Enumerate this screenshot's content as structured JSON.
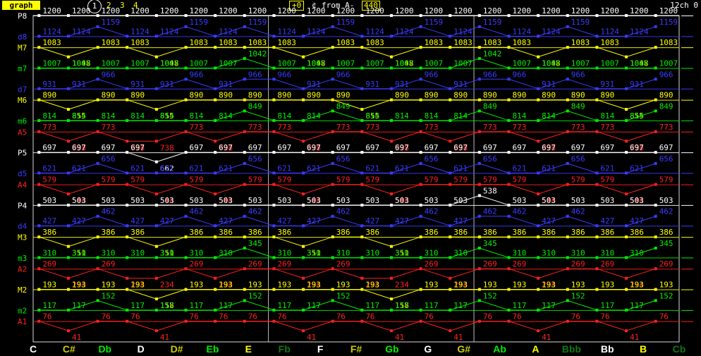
{
  "header": {
    "mode_label": "graph",
    "pages": [
      "1",
      "2",
      "3",
      "4"
    ],
    "offset": "+0",
    "cents": "¢",
    "from_label": "from A-",
    "ref_pitch": "440",
    "channel": "12ch 0"
  },
  "colors": {
    "P": "#ffffff",
    "M": "#ffff00",
    "m": "#00ee00",
    "d": "#3b3bff",
    "A": "#ff2020",
    "grid": "#d8d8d8"
  },
  "rows": [
    {
      "label": "P8",
      "color": "P",
      "values": [
        1200,
        1200,
        1200,
        1200,
        1200,
        1200,
        1200,
        1200,
        1200,
        1200,
        1200,
        1200,
        1200,
        1200,
        1200,
        1200,
        1200,
        1200,
        1200,
        1200,
        1200,
        1200
      ]
    },
    {
      "label": "d8",
      "color": "d",
      "values": [
        1124,
        1124,
        1159,
        1124,
        1124,
        1159,
        1124,
        1159,
        1124,
        1124,
        1159,
        1124,
        1124,
        1159,
        1124,
        1159,
        1124,
        1124,
        1159,
        1124,
        1124,
        1159
      ]
    },
    {
      "label": "M7",
      "color": "M",
      "values": [
        1083,
        1048,
        1083,
        1083,
        1048,
        1083,
        1083,
        1083,
        1083,
        1048,
        1083,
        1083,
        1048,
        1083,
        1083,
        1083,
        1083,
        1048,
        1083,
        1083,
        1048,
        1083
      ]
    },
    {
      "label": "m7",
      "color": "m",
      "values": [
        1007,
        1007,
        1007,
        1007,
        1007,
        1007,
        1007,
        1042,
        1007,
        1007,
        1007,
        1007,
        1007,
        1007,
        1007,
        1042,
        1007,
        1007,
        1007,
        1007,
        1007,
        1007
      ]
    },
    {
      "label": "d7",
      "color": "d",
      "values": [
        931,
        931,
        966,
        931,
        931,
        966,
        931,
        966,
        966,
        931,
        966,
        931,
        931,
        966,
        931,
        966,
        966,
        931,
        966,
        931,
        931,
        966
      ]
    },
    {
      "label": "M6",
      "color": "M",
      "values": [
        890,
        855,
        890,
        890,
        855,
        890,
        890,
        890,
        890,
        890,
        890,
        855,
        890,
        890,
        890,
        890,
        890,
        890,
        890,
        890,
        855,
        890
      ]
    },
    {
      "label": "m6",
      "color": "m",
      "values": [
        814,
        814,
        814,
        814,
        814,
        814,
        814,
        849,
        814,
        814,
        849,
        814,
        814,
        814,
        814,
        849,
        814,
        814,
        849,
        814,
        814,
        849
      ]
    },
    {
      "label": "A5",
      "color": "A",
      "values": [
        773,
        738,
        773,
        738,
        738,
        773,
        738,
        773,
        773,
        738,
        773,
        773,
        738,
        773,
        738,
        773,
        773,
        738,
        773,
        773,
        738,
        773
      ]
    },
    {
      "label": "P5",
      "color": "P",
      "values": [
        697,
        697,
        697,
        697,
        662,
        697,
        697,
        697,
        697,
        697,
        697,
        697,
        697,
        697,
        697,
        697,
        697,
        697,
        697,
        697,
        697,
        697
      ]
    },
    {
      "label": "d5",
      "color": "d",
      "values": [
        621,
        621,
        656,
        621,
        621,
        621,
        621,
        656,
        621,
        621,
        656,
        621,
        621,
        656,
        621,
        656,
        621,
        621,
        656,
        621,
        621,
        656
      ]
    },
    {
      "label": "A4",
      "color": "A",
      "values": [
        579,
        544,
        579,
        579,
        544,
        579,
        544,
        579,
        579,
        544,
        579,
        579,
        544,
        579,
        579,
        579,
        579,
        544,
        579,
        579,
        544,
        579
      ]
    },
    {
      "label": "P4",
      "color": "P",
      "values": [
        503,
        503,
        503,
        503,
        503,
        503,
        503,
        503,
        503,
        503,
        503,
        503,
        503,
        503,
        503,
        538,
        503,
        503,
        503,
        503,
        503,
        503
      ]
    },
    {
      "label": "d4",
      "color": "d",
      "values": [
        427,
        427,
        462,
        427,
        427,
        462,
        427,
        462,
        427,
        427,
        462,
        427,
        427,
        462,
        427,
        462,
        462,
        427,
        462,
        427,
        427,
        462
      ]
    },
    {
      "label": "M3",
      "color": "M",
      "values": [
        386,
        351,
        386,
        386,
        351,
        386,
        386,
        386,
        386,
        351,
        386,
        386,
        351,
        386,
        386,
        386,
        386,
        386,
        386,
        386,
        386,
        386
      ]
    },
    {
      "label": "m3",
      "color": "m",
      "values": [
        310,
        310,
        310,
        310,
        310,
        310,
        310,
        345,
        310,
        310,
        310,
        310,
        310,
        310,
        310,
        345,
        310,
        310,
        310,
        310,
        310,
        345
      ]
    },
    {
      "label": "A2",
      "color": "A",
      "values": [
        269,
        234,
        269,
        234,
        234,
        269,
        234,
        269,
        269,
        234,
        269,
        234,
        234,
        269,
        234,
        269,
        269,
        234,
        269,
        269,
        234,
        269
      ]
    },
    {
      "label": "M2",
      "color": "M",
      "values": [
        193,
        193,
        193,
        193,
        158,
        193,
        193,
        193,
        193,
        193,
        193,
        193,
        158,
        193,
        193,
        193,
        193,
        193,
        193,
        193,
        193,
        193
      ]
    },
    {
      "label": "m2",
      "color": "m",
      "values": [
        117,
        117,
        152,
        117,
        117,
        117,
        117,
        152,
        117,
        117,
        152,
        117,
        117,
        117,
        117,
        152,
        117,
        117,
        152,
        117,
        117,
        152
      ]
    },
    {
      "label": "A1",
      "color": "A",
      "values": [
        76,
        41,
        76,
        76,
        41,
        76,
        76,
        76,
        76,
        41,
        76,
        76,
        41,
        76,
        41,
        76,
        76,
        41,
        76,
        76,
        41,
        76
      ]
    }
  ],
  "bottom_notes": [
    {
      "name": "C",
      "color": "#ffffff"
    },
    {
      "name": "C#",
      "color": "#cccc00"
    },
    {
      "name": "Db",
      "color": "#00ee00"
    },
    {
      "name": "D",
      "color": "#ffffff"
    },
    {
      "name": "D#",
      "color": "#cccc00"
    },
    {
      "name": "Eb",
      "color": "#00ee00"
    },
    {
      "name": "E",
      "color": "#ffff00"
    },
    {
      "name": "Fb",
      "color": "#117711"
    },
    {
      "name": "F",
      "color": "#ffffff"
    },
    {
      "name": "F#",
      "color": "#cccc00"
    },
    {
      "name": "Gb",
      "color": "#00ee00"
    },
    {
      "name": "G",
      "color": "#ffffff"
    },
    {
      "name": "G#",
      "color": "#cccc00"
    },
    {
      "name": "Ab",
      "color": "#00ee00"
    },
    {
      "name": "A",
      "color": "#ffff00"
    },
    {
      "name": "Bbb",
      "color": "#117711"
    },
    {
      "name": "Bb",
      "color": "#ffffff"
    },
    {
      "name": "B",
      "color": "#ffff00"
    },
    {
      "name": "Cb",
      "color": "#117711"
    }
  ]
}
